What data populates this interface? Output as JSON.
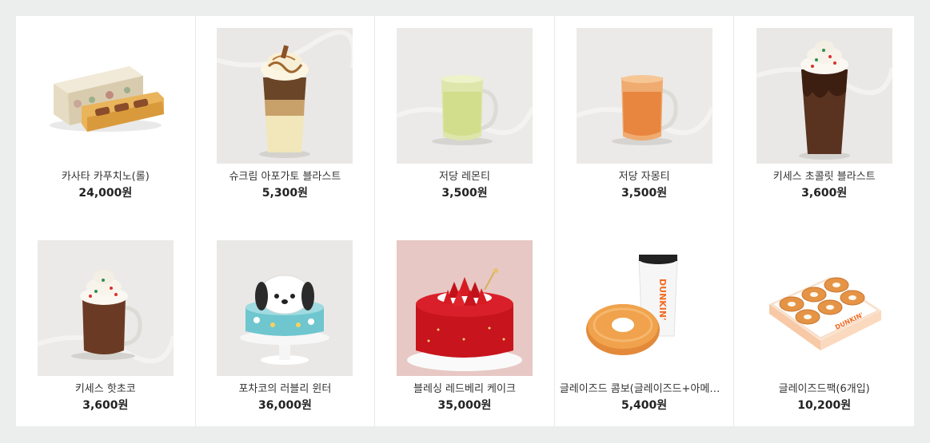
{
  "products": [
    {
      "name": "카사타 카푸치노(롤)",
      "price": "24,000원",
      "image": "cassata-roll-image"
    },
    {
      "name": "슈크림 아포가토 블라스트",
      "price": "5,300원",
      "image": "cream-affogato-blast-image"
    },
    {
      "name": "저당 레몬티",
      "price": "3,500원",
      "image": "lemon-tea-image"
    },
    {
      "name": "저당 자몽티",
      "price": "3,500원",
      "image": "grapefruit-tea-image"
    },
    {
      "name": "키세스 초콜릿 블라스트",
      "price": "3,600원",
      "image": "kisses-chocolate-blast-image"
    },
    {
      "name": "키세스 핫초코",
      "price": "3,600원",
      "image": "kisses-hot-chocolate-image"
    },
    {
      "name": "포차코의 러블리 윈터",
      "price": "36,000원",
      "image": "pochacco-cake-image"
    },
    {
      "name": "블레싱 레드베리 케이크",
      "price": "35,000원",
      "image": "redberry-cake-image"
    },
    {
      "name": "글레이즈드 콤보(글레이즈드+아메리카노)",
      "price": "5,400원",
      "image": "glazed-combo-image"
    },
    {
      "name": "글레이즈드팩(6개입)",
      "price": "10,200원",
      "image": "glazed-pack-image"
    }
  ],
  "brand": {
    "cup_text": "DUNKIN'",
    "box_text": "DUNKIN'"
  },
  "colors": {
    "text": "#333333",
    "price": "#222222",
    "background": "#eceeed",
    "dunkin_orange": "#f26b21",
    "dunkin_pink": "#e0218a"
  }
}
